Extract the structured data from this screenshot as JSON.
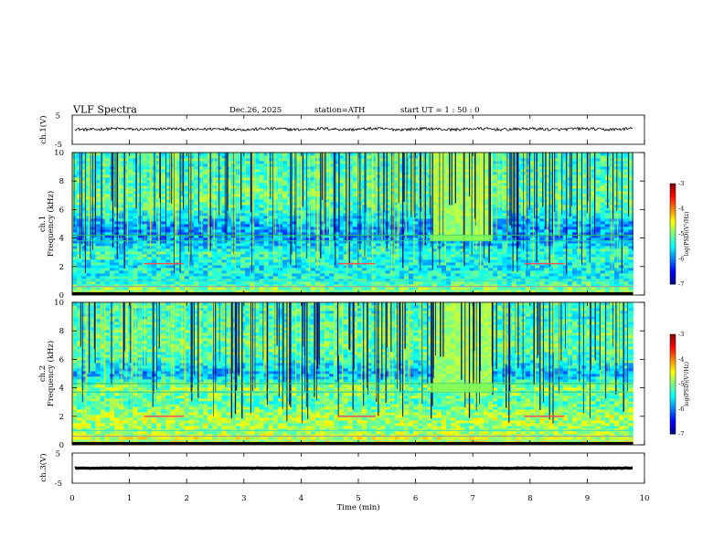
{
  "header": {
    "title": "VLF  Spectra",
    "date": "Dec.26, 2025",
    "station": "station=ATH",
    "start": "start  UT  =   1 : 50 : 0"
  },
  "chart_data": {
    "type": "heatmap",
    "xlabel": "Time  (min)",
    "xlim": [
      0,
      10
    ],
    "x_ticks": [
      "0",
      "1",
      "2",
      "3",
      "4",
      "5",
      "6",
      "7",
      "8",
      "9",
      "10"
    ],
    "panels": [
      {
        "id": "ch1_volt",
        "ylabel": "ch.1(V)",
        "ylim": [
          -5,
          5
        ],
        "y_ticks": [
          "5",
          "-5"
        ],
        "trace_mean": 0.2,
        "trace_noise": 0.5
      },
      {
        "id": "ch1_spectrogram",
        "ylabel_top": "ch.1",
        "ylabel": "Frequency  (kHz)",
        "ylim": [
          0,
          10
        ],
        "y_ticks": [
          "0",
          "2",
          "4",
          "6",
          "8",
          "10"
        ],
        "color_scale": {
          "label": "log(PSD)(V²/Hz)",
          "range": [
            -7,
            -3
          ],
          "ticks": [
            "-3",
            "-4",
            "-5",
            "-6",
            "-7"
          ]
        },
        "features": {
          "bright_band_khz": [
            3.8,
            4.2
          ],
          "bright_block_min": [
            6.25,
            7.35
          ],
          "hum_line_khz": 2.2,
          "hum_segments_min": [
            [
              1.25,
              1.95
            ],
            [
              4.65,
              5.3
            ],
            [
              7.9,
              8.6
            ]
          ]
        },
        "mean_level_by_freq": {
          "freq_khz": [
            0,
            1,
            2,
            3,
            4,
            5,
            6,
            7,
            8,
            9,
            10
          ],
          "log_psd": [
            -4.6,
            -5.4,
            -5.5,
            -5.3,
            -5.9,
            -5.8,
            -5.3,
            -5.1,
            -5.2,
            -5.3,
            -5.3
          ]
        }
      },
      {
        "id": "ch2_spectrogram",
        "ylabel_top": "ch.2",
        "ylabel": "Frequency  (kHz)",
        "ylim": [
          0,
          10
        ],
        "y_ticks": [
          "0",
          "2",
          "4",
          "6",
          "8",
          "10"
        ],
        "color_scale": {
          "label": "log(PSD)(V²/Hz)",
          "range": [
            -7,
            -3
          ],
          "ticks": [
            "-3",
            "-4",
            "-5",
            "-6",
            "-7"
          ]
        },
        "features": {
          "bright_band_khz": [
            3.7,
            4.3
          ],
          "bright_block_min": [
            6.25,
            7.35
          ],
          "hum_line_khz": 2.0,
          "hum_segments_min": [
            [
              1.25,
              1.95
            ],
            [
              4.65,
              5.3
            ],
            [
              7.9,
              8.6
            ]
          ]
        },
        "mean_level_by_freq": {
          "freq_khz": [
            0,
            1,
            2,
            3,
            4,
            5,
            6,
            7,
            8,
            9,
            10
          ],
          "log_psd": [
            -4.5,
            -4.9,
            -4.8,
            -5.2,
            -4.9,
            -5.8,
            -5.3,
            -5.1,
            -5.2,
            -5.3,
            -5.3
          ]
        }
      },
      {
        "id": "ch3_volt",
        "ylabel": "ch.3(V)",
        "ylim": [
          -5,
          5
        ],
        "y_ticks": [
          "5",
          "-5"
        ],
        "trace_mean": 0,
        "trace_noise": 0.1
      }
    ],
    "data_end_min": 9.8
  }
}
